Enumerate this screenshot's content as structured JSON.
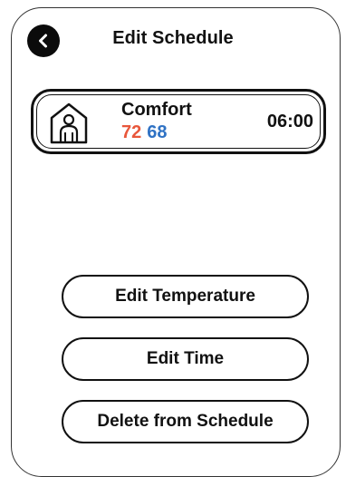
{
  "header": {
    "title": "Edit Schedule",
    "back_icon": "chevron-left-icon"
  },
  "schedule_entry": {
    "icon": "person-in-house-icon",
    "mode_name": "Comfort",
    "heat_setpoint": "72",
    "cool_setpoint": "68",
    "time": "06:00"
  },
  "actions": {
    "edit_temperature_label": "Edit Temperature",
    "edit_time_label": "Edit Time",
    "delete_label": "Delete from Schedule"
  },
  "colors": {
    "heat": "#e8573b",
    "cool": "#2f72c4",
    "outline": "#111111",
    "background": "#ffffff"
  }
}
